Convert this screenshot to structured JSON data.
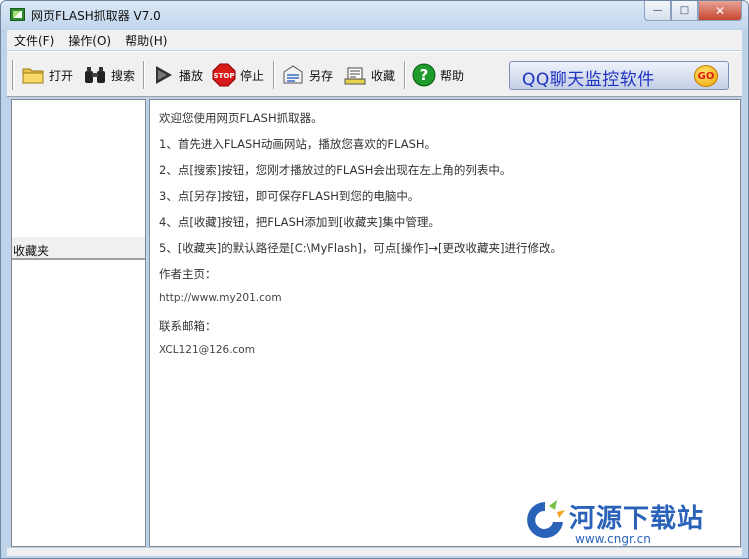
{
  "window": {
    "title": "网页FLASH抓取器 V7.0",
    "controls": {
      "minimize": "—",
      "maximize": "□",
      "close": "✕"
    }
  },
  "menu": [
    {
      "label": "文件(F)"
    },
    {
      "label": "操作(O)"
    },
    {
      "label": "帮助(H)"
    }
  ],
  "toolbar": {
    "open": {
      "label": "打开",
      "icon": "folder-icon"
    },
    "search": {
      "label": "搜索",
      "icon": "binoculars-icon"
    },
    "play": {
      "label": "播放",
      "icon": "play-icon"
    },
    "stop": {
      "label": "停止",
      "icon": "stop-sign-icon",
      "icon_text": "STOP"
    },
    "saveas": {
      "label": "另存",
      "icon": "save-as-icon"
    },
    "favorite": {
      "label": "收藏",
      "icon": "favorite-icon"
    },
    "help": {
      "label": "帮助",
      "icon": "help-icon",
      "icon_text": "?"
    }
  },
  "banner": {
    "text": "QQ聊天监控软件",
    "go": "GO"
  },
  "left_panel": {
    "header": "收藏夹"
  },
  "content": {
    "lines": [
      "欢迎您使用网页FLASH抓取器。",
      "1、首先进入FLASH动画网站，播放您喜欢的FLASH。",
      "2、点[搜索]按钮，您刚才播放过的FLASH会出现在左上角的列表中。",
      "3、点[另存]按钮，即可保存FLASH到您的电脑中。",
      "4、点[收藏]按钮，把FLASH添加到[收藏夹]集中管理。",
      "5、[收藏夹]的默认路径是[C:\\MyFlash]，可点[操作]→[更改收藏夹]进行修改。",
      "作者主页：",
      "http://www.my201.com",
      "联系邮箱：",
      "XCL121@126.com"
    ]
  },
  "watermark": {
    "title": "河源下载站",
    "url": "www.cngr.cn"
  },
  "colors": {
    "title_bar": "#c2d6ec",
    "banner_text": "#1f33c2",
    "watermark": "#2a62b9",
    "close_button": "#c6462f"
  }
}
